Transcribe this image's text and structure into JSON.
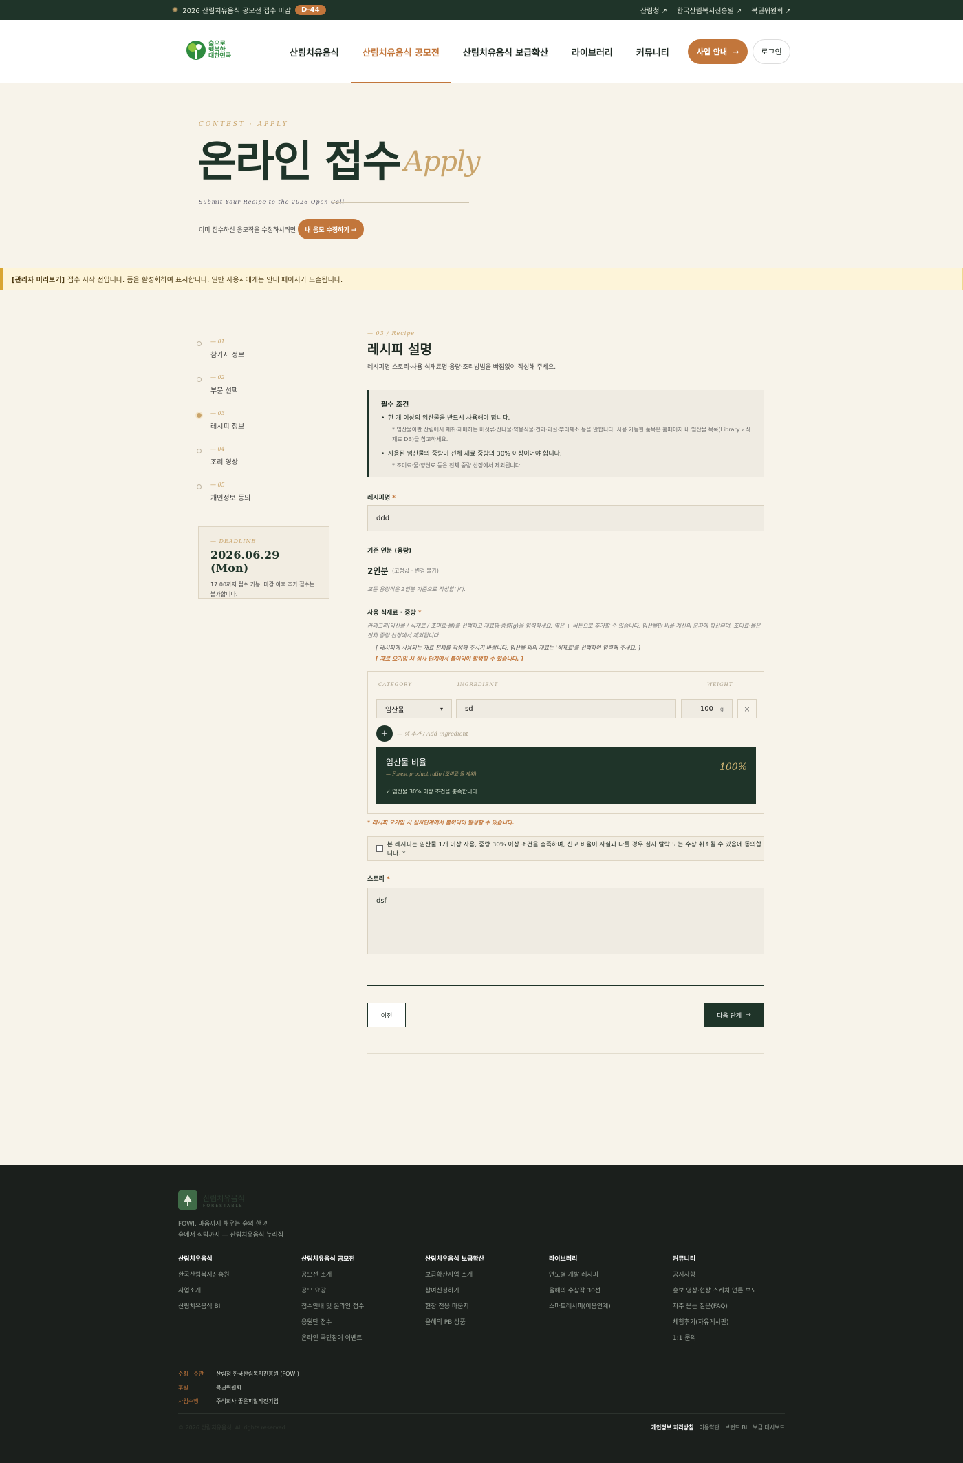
{
  "topbar": {
    "announcement": "2026 산림치유음식 공모전 접수 마감",
    "dday": "D-44",
    "links": [
      "산림청",
      "한국산림복지진흥원",
      "복권위원회"
    ]
  },
  "header": {
    "logo_lines": [
      "숲으로",
      "행복한",
      "대한민국"
    ],
    "nav": [
      "산림치유음식",
      "산림치유음식 공모전",
      "산림치유음식 보급확산",
      "라이브러리",
      "커뮤니티"
    ],
    "active_nav": 1,
    "business_btn": "사업 안내",
    "login_btn": "로그인"
  },
  "hero": {
    "kicker": "CONTEST · APPLY",
    "title": "온라인 접수",
    "title_en": "Apply",
    "subtitle": "Submit Your Recipe to the 2026 Open Call",
    "note": "이미 접수하신 응모작을 수정하시려면",
    "edit_btn": "내 응모 수정하기 →"
  },
  "admin_banner": {
    "tag": "[관리자 미리보기]",
    "text": "접수 시작 전입니다. 폼을 활성화하여 표시합니다. 일반 사용자에게는 안내 페이지가 노출됩니다."
  },
  "steps": [
    {
      "num": "— 01",
      "label": "참가자 정보"
    },
    {
      "num": "— 02",
      "label": "부문 선택"
    },
    {
      "num": "— 03",
      "label": "레시피 정보"
    },
    {
      "num": "— 04",
      "label": "조리 영상"
    },
    {
      "num": "— 05",
      "label": "개인정보 동의"
    }
  ],
  "active_step": 2,
  "deadline": {
    "kicker": "— DEADLINE",
    "date": "2026.06.29 (Mon)",
    "note": "17:00까지 접수 가능. 마감 이후 추가 접수는 불가합니다."
  },
  "form": {
    "kicker": "— 03 / Recipe",
    "title": "레시피 설명",
    "desc": "레시피명·스토리·사용 식재료명·용량·조리방법을 빠짐없이 작성해 주세요.",
    "req_title": "필수 조건",
    "req_1": "한 개 이상의 임산물을 반드시 사용해야 합니다.",
    "req_1_note": "* 임산물이란 산림에서 채취·재배하는 버섯류·산나물·약용식물·견과·과실·뿌리채소 등을 말합니다. 사용 가능한 품목은 홈페이지 내 임산물 목록(Library › 식재료 DB)을 참고하세요.",
    "req_2": "사용된 임산물의 중량이 전체 재료 중량의 30% 이상이어야 합니다.",
    "req_2_note": "* 조미료·물·향신료 등은 전체 중량 산정에서 제외됩니다.",
    "recipe_name_label": "레시피명",
    "recipe_name_value": "ddd",
    "serving_label": "기준 인분 (용량)",
    "serving_value": "2인분",
    "serving_note": "(고정값 · 변경 불가)",
    "serving_hint": "모든 용량적은 2인분 기준으로 작성합니다.",
    "ing_label": "사용 식재료 · 중량",
    "ing_note": "카테고리(임산물 / 식재료 / 조미료·물)를 선택하고 재료명·중량(g)을 입력하세요. 옆은 + 버튼으로 추가할 수 있습니다. 임산물만 비율 계산의 분자에 합산되며, 조미료·물은 전체 중량 산정에서 제외됩니다.",
    "ing_note_2": "[ 레시피에 사용되는 재료 전체를 작성해 주시기 바랍니다. 임산물 외의 재료는 '식재료'를 선택하여 입력해 주세요. ]",
    "ing_note_3": "[ 재료 오기입 시 심사 단계에서 불이익이 발생할 수 있습니다. ]",
    "col_category": "CATEGORY",
    "col_ingredient": "INGREDIENT",
    "col_weight": "WEIGHT",
    "row_category": "임산물",
    "row_ingredient": "sd",
    "row_weight": "100",
    "row_unit": "g",
    "remove": "×",
    "add_label": "— 행 추가 / Add ingredient",
    "ratio_title": "임산물 비율",
    "ratio_sub": "— Forest product ratio (조미료·물 제외)",
    "ratio_value": "100%",
    "ratio_ok": "✓ 임산물 30% 이상 조건을 충족합니다.",
    "warn": "* 레시피 오기입 시 심사단계에서 불이익이 발생할 수 있습니다.",
    "agree": "본 레시피는 임산물 1개 이상 사용, 중량 30% 이상 조건을 충족하며, 신고 비율이 사실과 다를 경우 심사 탈락 또는 수상 취소될 수 있음에 동의합니다. *",
    "story_label": "스토리",
    "story_value": "dsf",
    "prev_btn": "이전",
    "next_btn": "다음 단계"
  },
  "footer": {
    "logo_name": "산림치유음식",
    "logo_sub": "FORESTABLE",
    "tagline_1": "FOWI, 마음까지 채우는 숲의 한 끼",
    "tagline_2": "숲에서 식탁까지 — 산림치유음식 누리집",
    "cols": [
      {
        "h": "산림치유음식",
        "items": [
          "한국산림복지진흥원",
          "사업소개",
          "산림치유음식 BI"
        ]
      },
      {
        "h": "산림치유음식 공모전",
        "items": [
          "공모전 소개",
          "공모 요강",
          "접수안내 및 온라인 접수",
          "응원단 접수",
          "온라인 국민참여 이벤트"
        ]
      },
      {
        "h": "산림치유음식 보급확산",
        "items": [
          "보급확산사업 소개",
          "참여신청하기",
          "현장 전용 마운지",
          "올해의 PB 상품"
        ]
      },
      {
        "h": "라이브러리",
        "items": [
          "연도별 개발 레시피",
          "올해의 수상작 30선",
          "스마트레시피(이음연계)"
        ]
      },
      {
        "h": "커뮤니티",
        "items": [
          "공지사항",
          "홍보 영상·현장 스케치·언론 보도",
          "자주 묻는 질문(FAQ)",
          "체험후기(자유게시판)",
          "1:1 문의"
        ]
      }
    ],
    "org": [
      {
        "k": "주최 · 주관",
        "v": "산림청    한국산림복지진흥원 (FOWI)"
      },
      {
        "k": "후원",
        "v": "복권위원회"
      },
      {
        "k": "사업수행",
        "v": "주식회사 좋은피알작전기업"
      }
    ],
    "copyright": "© 2026 산림치유음식. All rights reserved.",
    "bottom_links": [
      "개인정보 처리방침",
      "이용약관",
      "브랜드 BI",
      "보급 대시보드"
    ]
  }
}
